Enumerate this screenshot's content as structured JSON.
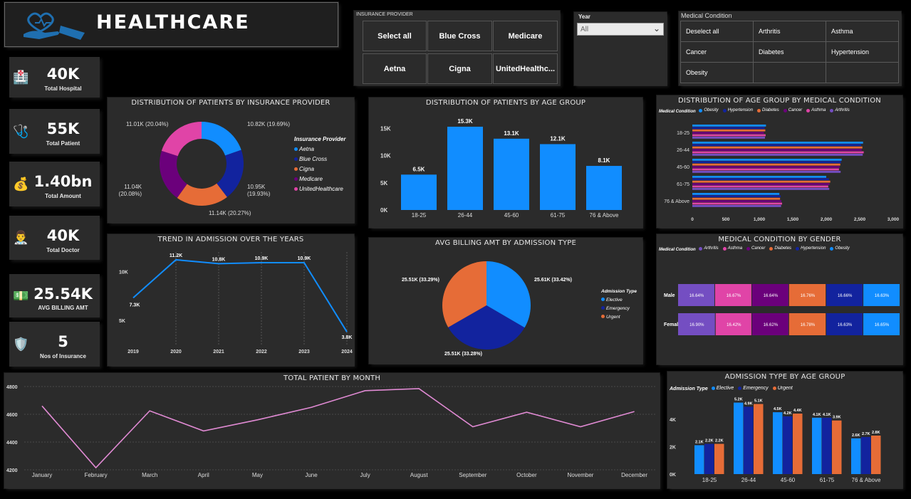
{
  "header": {
    "title": "HEALTHCARE",
    "logo_icon": "heart-hand-icon"
  },
  "kpis": [
    {
      "value": "40K",
      "label": "Total Hospital",
      "icon": "hospital-icon"
    },
    {
      "value": "55K",
      "label": "Total Patient",
      "icon": "patient-icon"
    },
    {
      "value": "1.40bn",
      "label": "Total Amount",
      "icon": "money-bag-icon"
    },
    {
      "value": "40K",
      "label": "Total Doctor",
      "icon": "doctor-icon"
    },
    {
      "value": "25.54K",
      "label": "AVG BILLING AMT",
      "icon": "billing-icon"
    },
    {
      "value": "5",
      "label": "Nos of Insurance",
      "icon": "insurance-icon"
    }
  ],
  "insurance_slicer": {
    "title": "INSURANCE PROVIDER",
    "options": [
      "Select all",
      "Blue Cross",
      "Medicare",
      "Aetna",
      "Cigna",
      "UnitedHealthc..."
    ]
  },
  "year_slicer": {
    "title": "Year",
    "value": "All"
  },
  "condition_slicer": {
    "title": "Medical Condition",
    "options": [
      "Deselect all",
      "Arthritis",
      "Asthma",
      "Cancer",
      "Diabetes",
      "Hypertension",
      "Obesity",
      "",
      ""
    ]
  },
  "colors": {
    "aetna": "#118dff",
    "bluecross": "#12239e",
    "cigna": "#e66c37",
    "medicare": "#6b007b",
    "united": "#e044a7",
    "bar": "#118dff",
    "line": "#e08ad3"
  },
  "charts": {
    "insurance_donut": {
      "title": "DISTRIBUTION OF PATIENTS BY INSURANCE PROVIDER",
      "legend_title": "Insurance Provider",
      "chart_data": {
        "type": "pie",
        "categories": [
          "Aetna",
          "Blue Cross",
          "Cigna",
          "Medicare",
          "UnitedHealthcare"
        ],
        "values": [
          10.82,
          10.95,
          11.14,
          11.04,
          11.01
        ],
        "labels": [
          "10.82K (19.69%)",
          "10.95K (19.93%)",
          "11.14K (20.27%)",
          "11.04K (20.08%)",
          "11.01K (20.04%)"
        ]
      }
    },
    "age_group": {
      "title": "DISTRIBUTION OF PATIENTS BY AGE GROUP",
      "chart_data": {
        "type": "bar",
        "categories": [
          "18-25",
          "26-44",
          "45-60",
          "61-75",
          "76 & Above"
        ],
        "values": [
          6.5,
          15.3,
          13.1,
          12.1,
          8.1
        ],
        "labels": [
          "6.5K",
          "15.3K",
          "13.1K",
          "12.1K",
          "8.1K"
        ],
        "yticks": [
          "0K",
          "5K",
          "10K",
          "15K"
        ],
        "ylim": [
          0,
          17
        ]
      }
    },
    "age_by_condition": {
      "title": "DISTRIBUTION OF AGE GROUP BY MEDICAL CONDITION",
      "legend_title": "Medical Condition",
      "chart_data": {
        "type": "bar",
        "categories": [
          "18-25",
          "26-44",
          "45-60",
          "61-75",
          "76 & Above"
        ],
        "series": [
          {
            "name": "Obesity",
            "color": "#118dff",
            "values": [
              1100,
              2550,
              2230,
              2000,
              1300
            ]
          },
          {
            "name": "Hypertension",
            "color": "#12239e",
            "values": [
              1080,
              2520,
              2220,
              2040,
              1320
            ]
          },
          {
            "name": "Diabetes",
            "color": "#e66c37",
            "values": [
              1090,
              2540,
              2210,
              2060,
              1310
            ]
          },
          {
            "name": "Cancer",
            "color": "#6b007b",
            "values": [
              1070,
              2530,
              2200,
              2050,
              1330
            ]
          },
          {
            "name": "Asthma",
            "color": "#e044a7",
            "values": [
              1095,
              2560,
              2190,
              2030,
              1340
            ]
          },
          {
            "name": "Arthritis",
            "color": "#744ec2",
            "values": [
              1085,
              2545,
              2215,
              2045,
              1325
            ]
          }
        ],
        "xticks": [
          "0",
          "500",
          "1,000",
          "1,500",
          "2,000",
          "2,500",
          "3,000"
        ],
        "xlim": [
          0,
          3000
        ]
      }
    },
    "admission_trend": {
      "title": "TREND IN ADMISSION OVER THE YEARS",
      "chart_data": {
        "type": "line",
        "x": [
          "2019",
          "2020",
          "2021",
          "2022",
          "2023",
          "2024"
        ],
        "values": [
          7.3,
          11.2,
          10.8,
          10.9,
          10.9,
          3.8
        ],
        "labels": [
          "7.3K",
          "11.2K",
          "10.8K",
          "10.9K",
          "10.9K",
          "3.8K"
        ],
        "yticks": [
          "5K",
          "10K"
        ],
        "ylim": [
          2.5,
          12
        ]
      }
    },
    "billing_by_type": {
      "title": "AVG BILLING AMT BY ADMISSION TYPE",
      "legend_title": "Admission Type",
      "chart_data": {
        "type": "pie",
        "categories": [
          "Elective",
          "Emergency",
          "Urgent"
        ],
        "values": [
          25.61,
          25.51,
          25.51
        ],
        "labels": [
          "25.61K (33.42%)",
          "25.51K (33.28%)",
          "25.51K (33.29%)"
        ],
        "colors": [
          "#118dff",
          "#12239e",
          "#e66c37"
        ]
      }
    },
    "condition_by_gender": {
      "title": "MEDICAL CONDITION BY GENDER",
      "legend_title": "Medical Condition",
      "chart_data": {
        "type": "bar",
        "categories": [
          "Male",
          "Female"
        ],
        "series": [
          {
            "name": "Arthritis",
            "color": "#744ec2",
            "values": [
              "16.64%",
              "16.90%"
            ]
          },
          {
            "name": "Asthma",
            "color": "#e044a7",
            "values": [
              "16.67%",
              "16.42%"
            ]
          },
          {
            "name": "Cancer",
            "color": "#6b007b",
            "values": [
              "16.64%",
              "16.62%"
            ]
          },
          {
            "name": "Diabetes",
            "color": "#e66c37",
            "values": [
              "16.76%",
              "16.78%"
            ]
          },
          {
            "name": "Hypertension",
            "color": "#12239e",
            "values": [
              "16.66%",
              "16.63%"
            ]
          },
          {
            "name": "Obesity",
            "color": "#118dff",
            "values": [
              "16.63%",
              "16.65%"
            ]
          }
        ]
      }
    },
    "patient_by_month": {
      "title": "TOTAL PATIENT BY MONTH",
      "chart_data": {
        "type": "line",
        "x": [
          "January",
          "February",
          "March",
          "April",
          "May",
          "June",
          "July",
          "August",
          "September",
          "October",
          "November",
          "December"
        ],
        "values": [
          4660,
          4215,
          4625,
          4480,
          4560,
          4650,
          4770,
          4785,
          4510,
          4615,
          4510,
          4620
        ],
        "yticks": [
          "4200",
          "4400",
          "4600",
          "4800"
        ],
        "ylim": [
          4200,
          4800
        ]
      }
    },
    "admission_by_age": {
      "title": "ADMISSION TYPE BY AGE GROUP",
      "legend_title": "Admission Type",
      "chart_data": {
        "type": "bar",
        "categories": [
          "18-25",
          "26-44",
          "45-60",
          "61-75",
          "76 & Above"
        ],
        "series": [
          {
            "name": "Elective",
            "color": "#118dff",
            "values": [
              2.1,
              5.2,
              4.5,
              4.1,
              2.6
            ],
            "labels": [
              "2.1K",
              "5.2K",
              "4.5K",
              "4.1K",
              "2.6K"
            ]
          },
          {
            "name": "Emergency",
            "color": "#12239e",
            "values": [
              2.2,
              4.9,
              4.2,
              4.1,
              2.7
            ],
            "labels": [
              "2.2K",
              "4.9K",
              "4.2K",
              "4.1K",
              "2.7K"
            ]
          },
          {
            "name": "Urgent",
            "color": "#e66c37",
            "values": [
              2.2,
              5.1,
              4.4,
              3.9,
              2.8
            ],
            "labels": [
              "2.2K",
              "5.1K",
              "4.4K",
              "3.9K",
              "2.8K"
            ]
          }
        ],
        "yticks": [
          "0K",
          "2K",
          "4K"
        ],
        "ylim": [
          0,
          5.8
        ]
      }
    }
  }
}
